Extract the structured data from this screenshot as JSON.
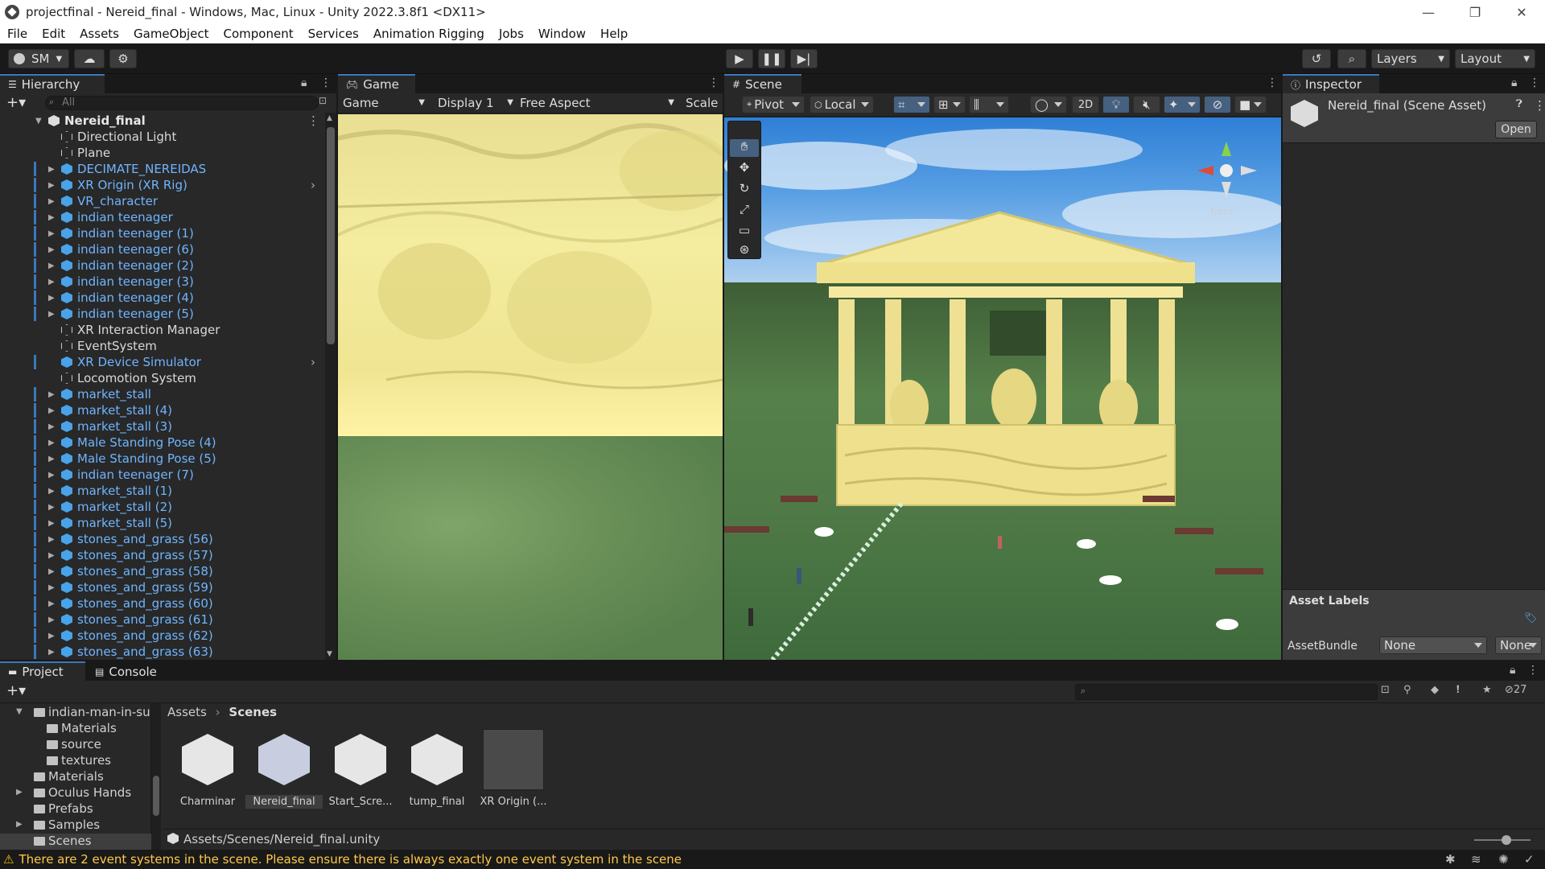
{
  "window": {
    "title": "projectfinal - Nereid_final - Windows, Mac, Linux - Unity 2022.3.8f1 <DX11>",
    "controls": [
      "—",
      "❐",
      "✕"
    ]
  },
  "menu": [
    "File",
    "Edit",
    "Assets",
    "GameObject",
    "Component",
    "Services",
    "Animation Rigging",
    "Jobs",
    "Window",
    "Help"
  ],
  "toolbar": {
    "account": "SM",
    "layers": "Layers",
    "layout": "Layout"
  },
  "hierarchy": {
    "tab": "Hierarchy",
    "search_placeholder": "All",
    "scene": "Nereid_final",
    "items": [
      {
        "label": "Directional Light",
        "type": "obj",
        "arrow": false
      },
      {
        "label": "Plane",
        "type": "obj",
        "arrow": false
      },
      {
        "label": "DECIMATE_NEREIDAS",
        "type": "prefab",
        "arrow": true
      },
      {
        "label": "XR Origin (XR Rig)",
        "type": "prefab",
        "arrow": true,
        "more": true
      },
      {
        "label": "VR_character",
        "type": "prefab",
        "arrow": true
      },
      {
        "label": "indian teenager",
        "type": "prefab",
        "arrow": true
      },
      {
        "label": "indian teenager (1)",
        "type": "prefab",
        "arrow": true
      },
      {
        "label": "indian teenager (6)",
        "type": "prefab",
        "arrow": true
      },
      {
        "label": "indian teenager (2)",
        "type": "prefab",
        "arrow": true
      },
      {
        "label": "indian teenager (3)",
        "type": "prefab",
        "arrow": true
      },
      {
        "label": "indian teenager (4)",
        "type": "prefab",
        "arrow": true
      },
      {
        "label": "indian teenager (5)",
        "type": "prefab",
        "arrow": true
      },
      {
        "label": "XR Interaction Manager",
        "type": "obj",
        "arrow": false
      },
      {
        "label": "EventSystem",
        "type": "obj",
        "arrow": false
      },
      {
        "label": "XR Device Simulator",
        "type": "prefab",
        "arrow": false,
        "more": true
      },
      {
        "label": "Locomotion System",
        "type": "obj",
        "arrow": false
      },
      {
        "label": "market_stall",
        "type": "prefab",
        "arrow": true
      },
      {
        "label": "market_stall (4)",
        "type": "prefab",
        "arrow": true
      },
      {
        "label": "market_stall (3)",
        "type": "prefab",
        "arrow": true
      },
      {
        "label": "Male Standing Pose (4)",
        "type": "prefab",
        "arrow": true
      },
      {
        "label": "Male Standing Pose (5)",
        "type": "prefab",
        "arrow": true
      },
      {
        "label": "indian teenager (7)",
        "type": "prefab",
        "arrow": true
      },
      {
        "label": "market_stall (1)",
        "type": "prefab",
        "arrow": true
      },
      {
        "label": "market_stall (2)",
        "type": "prefab",
        "arrow": true
      },
      {
        "label": "market_stall (5)",
        "type": "prefab",
        "arrow": true
      },
      {
        "label": "stones_and_grass (56)",
        "type": "prefab",
        "arrow": true
      },
      {
        "label": "stones_and_grass (57)",
        "type": "prefab",
        "arrow": true
      },
      {
        "label": "stones_and_grass (58)",
        "type": "prefab",
        "arrow": true
      },
      {
        "label": "stones_and_grass (59)",
        "type": "prefab",
        "arrow": true
      },
      {
        "label": "stones_and_grass (60)",
        "type": "prefab",
        "arrow": true
      },
      {
        "label": "stones_and_grass (61)",
        "type": "prefab",
        "arrow": true
      },
      {
        "label": "stones_and_grass (62)",
        "type": "prefab",
        "arrow": true
      },
      {
        "label": "stones_and_grass (63)",
        "type": "prefab",
        "arrow": true
      }
    ]
  },
  "game": {
    "tab": "Game",
    "mode": "Game",
    "display": "Display 1",
    "aspect": "Free Aspect",
    "scale": "Scale"
  },
  "scene": {
    "tab": "Scene",
    "pivot": "Pivot",
    "local": "Local",
    "two_d": "2D",
    "gizmo_label": "Front"
  },
  "inspector": {
    "tab": "Inspector",
    "asset_name": "Nereid_final (Scene Asset)",
    "open": "Open",
    "asset_labels": "Asset Labels",
    "assetbundle_label": "AssetBundle",
    "assetbundle_value": "None",
    "variant_value": "None"
  },
  "project": {
    "tabs": [
      "Project",
      "Console"
    ],
    "tree": [
      {
        "label": "indian-man-in-su",
        "indent": 1,
        "arrow": "down"
      },
      {
        "label": "Materials",
        "indent": 2
      },
      {
        "label": "source",
        "indent": 2
      },
      {
        "label": "textures",
        "indent": 2
      },
      {
        "label": "Materials",
        "indent": 1
      },
      {
        "label": "Oculus Hands",
        "indent": 1,
        "arrow": "right"
      },
      {
        "label": "Prefabs",
        "indent": 1
      },
      {
        "label": "Samples",
        "indent": 1,
        "arrow": "right"
      },
      {
        "label": "Scenes",
        "indent": 1,
        "selected": true
      }
    ],
    "breadcrumb": [
      "Assets",
      "Scenes"
    ],
    "assets": [
      {
        "label": "Charminar"
      },
      {
        "label": "Nereid_final",
        "selected": true
      },
      {
        "label": "Start_Scre..."
      },
      {
        "label": "tump_final"
      },
      {
        "label": "XR Origin (...",
        "prefab": true
      }
    ],
    "path": "Assets/Scenes/Nereid_final.unity",
    "hidden_count": "27"
  },
  "status": {
    "message": "There are 2 event systems in the scene. Please ensure there is always exactly one event system in the scene"
  }
}
